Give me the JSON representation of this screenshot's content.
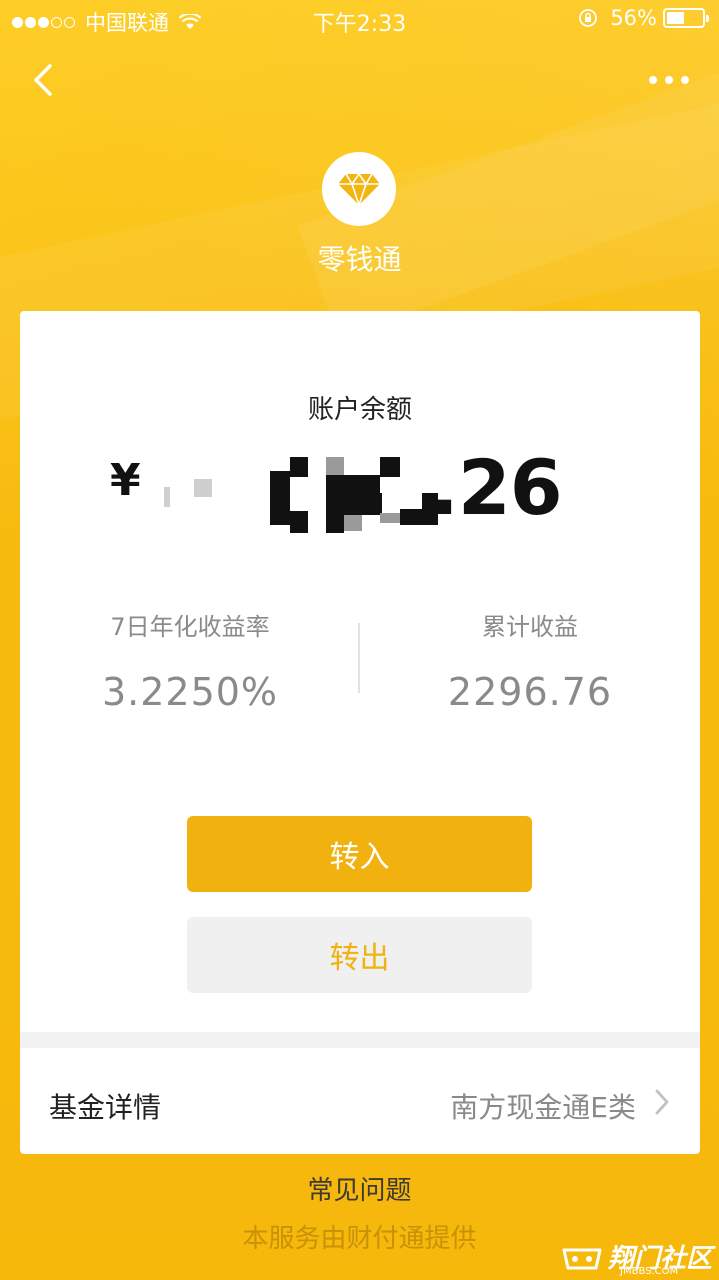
{
  "status_bar": {
    "carrier": "中国联通",
    "time": "下午2:33",
    "battery_percent": "56%",
    "battery_level": 0.56
  },
  "nav": {
    "back_icon": "chevron-left-icon",
    "more_icon": "more-dots-icon"
  },
  "product": {
    "icon": "diamond-icon",
    "name": "零钱通"
  },
  "balance": {
    "label": "账户余额",
    "currency": "¥",
    "amount_visible_tail": ".26"
  },
  "stats": {
    "yield_label": "7日年化收益率",
    "yield_value": "3.2250%",
    "earnings_label": "累计收益",
    "earnings_value": "2296.76"
  },
  "actions": {
    "transfer_in": "转入",
    "transfer_out": "转出"
  },
  "fund": {
    "label": "基金详情",
    "value": "南方现金通E类"
  },
  "footer": {
    "faq": "常见问题",
    "provider": "本服务由财付通提供"
  },
  "watermark": {
    "text": "翔门社区",
    "sub": "JMBBS.COM"
  },
  "colors": {
    "background": "#f6b90c",
    "primary_button": "#f1b20f",
    "secondary_button": "#f0f0f0"
  }
}
